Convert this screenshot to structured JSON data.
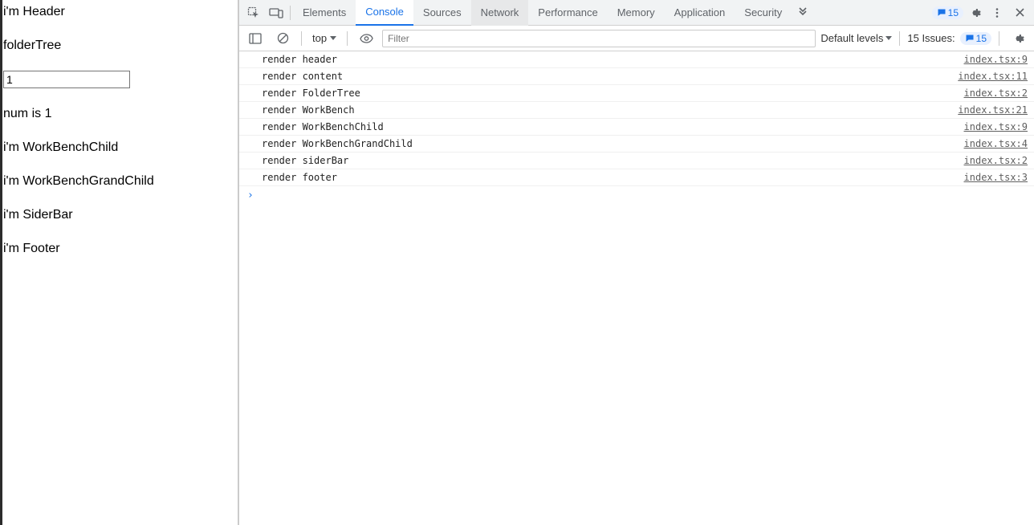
{
  "app": {
    "header": "i'm Header",
    "folderTree": "folderTree",
    "inputValue": "1",
    "numLabel": "num is 1",
    "workbenchChild": "i'm WorkBenchChild",
    "workbenchGrandChild": "i'm WorkBenchGrandChild",
    "siderBar": "i'm SiderBar",
    "footer": "i'm Footer"
  },
  "devtools": {
    "tabs": [
      "Elements",
      "Console",
      "Sources",
      "Network",
      "Performance",
      "Memory",
      "Application",
      "Security"
    ],
    "activeTab": "Console",
    "hoverTab": "Network",
    "msgCount": "15",
    "toolbar": {
      "contextLabel": "top",
      "filterPlaceholder": "Filter",
      "levels": "Default levels",
      "issuesLabel": "15 Issues:",
      "issuesCount": "15"
    },
    "logs": [
      {
        "msg": "render header",
        "src": "index.tsx:9"
      },
      {
        "msg": "render content",
        "src": "index.tsx:11"
      },
      {
        "msg": "render FolderTree",
        "src": "index.tsx:2"
      },
      {
        "msg": "render WorkBench",
        "src": "index.tsx:21"
      },
      {
        "msg": "render WorkBenchChild",
        "src": "index.tsx:9"
      },
      {
        "msg": "render WorkBenchGrandChild",
        "src": "index.tsx:4"
      },
      {
        "msg": "render siderBar",
        "src": "index.tsx:2"
      },
      {
        "msg": "render footer",
        "src": "index.tsx:3"
      }
    ]
  }
}
